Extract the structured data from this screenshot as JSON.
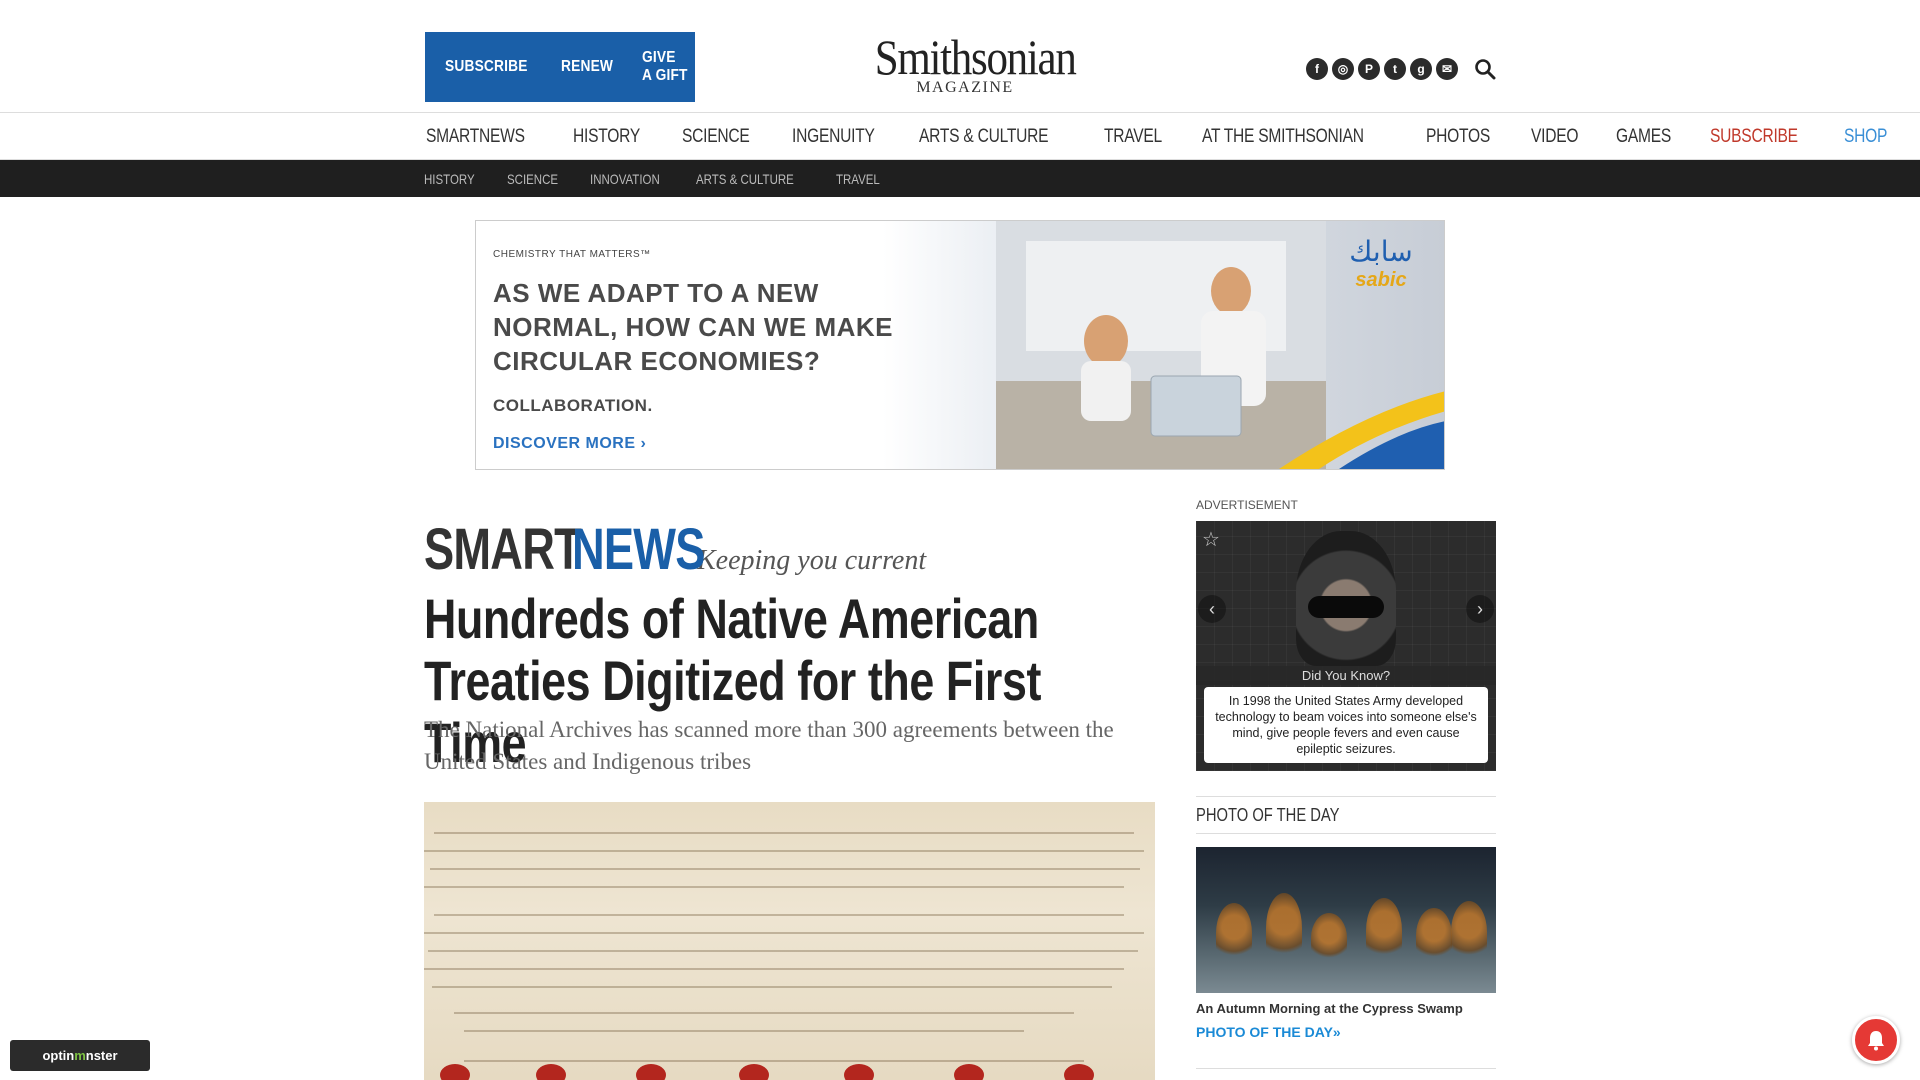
{
  "header": {
    "subscribe_links": [
      "SUBSCRIBE",
      "RENEW",
      "GIVE A GIFT"
    ],
    "logo_main": "Smithsonian",
    "logo_sub": "MAGAZINE",
    "socials": [
      {
        "icon": "facebook-icon",
        "glyph": "f"
      },
      {
        "icon": "instagram-icon",
        "glyph": "◎"
      },
      {
        "icon": "pinterest-icon",
        "glyph": "P"
      },
      {
        "icon": "twitter-icon",
        "glyph": "t"
      },
      {
        "icon": "google-plus-icon",
        "glyph": "g"
      },
      {
        "icon": "email-icon",
        "glyph": "✉"
      }
    ],
    "search_icon": "search-icon"
  },
  "main_nav": [
    "SMARTNEWS",
    "HISTORY",
    "SCIENCE",
    "INGENUITY",
    "ARTS & CULTURE",
    "TRAVEL",
    "AT THE SMITHSONIAN",
    "PHOTOS",
    "VIDEO",
    "GAMES",
    "SUBSCRIBE",
    "SHOP"
  ],
  "sub_nav": [
    "HISTORY",
    "SCIENCE",
    "INNOVATION",
    "ARTS & CULTURE",
    "TRAVEL"
  ],
  "banner_ad": {
    "tagline": "CHEMISTRY THAT MATTERS™",
    "headline": "AS WE ADAPT TO A NEW NORMAL, HOW CAN WE MAKE CIRCULAR ECONOMIES?",
    "subline": "COLLABORATION.",
    "cta": "DISCOVER MORE ›",
    "brand_ar": "سابك",
    "brand_en": "sabic"
  },
  "article": {
    "section_smart": "SMART",
    "section_news": "NEWS",
    "section_tagline": "Keeping you current",
    "title": "Hundreds of Native American Treaties Digitized for the First Time",
    "dek": "The National Archives has scanned more than 300 agreements between the United States and Indigenous tribes"
  },
  "sidebar": {
    "ad_label": "ADVERTISEMENT",
    "did_you_know": {
      "heading": "Did You Know?",
      "text": "In 1998 the United States Army developed technology to beam voices into someone else's mind, give people fevers and even cause epileptic seizures."
    },
    "photo_of_day": {
      "heading": "PHOTO OF THE DAY",
      "caption": "An Autumn Morning at the Cypress Swamp",
      "link": "PHOTO OF THE DAY»"
    }
  },
  "optinmonster": {
    "pre": "optin",
    "mid": "m",
    "post": "nster"
  },
  "colors": {
    "brand_blue": "#1a5fa8",
    "subscribe_red": "#c0392b",
    "shop_blue": "#3a8fd6",
    "bell_red": "#e53935"
  }
}
